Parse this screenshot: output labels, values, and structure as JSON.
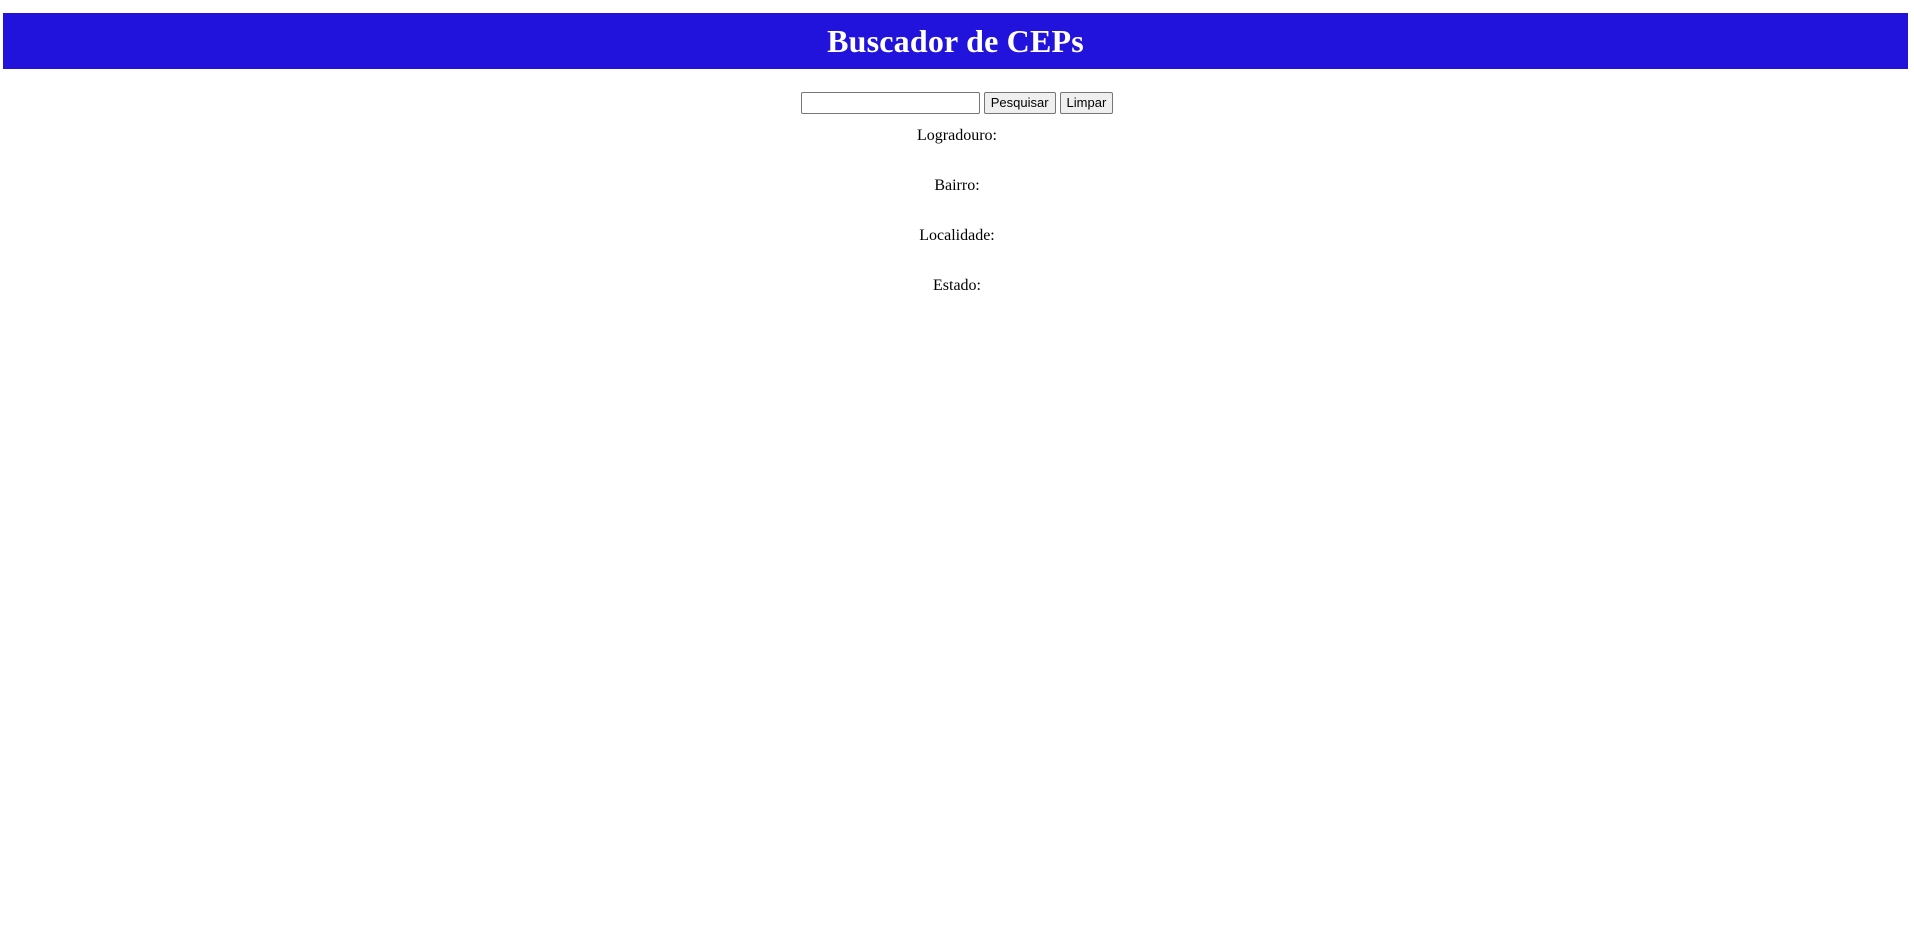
{
  "header": {
    "title": "Buscador de CEPs",
    "background_color": "#2112dc",
    "text_color": "#ffffff"
  },
  "search": {
    "input_value": "",
    "input_placeholder": "",
    "search_button_label": "Pesquisar",
    "clear_button_label": "Limpar"
  },
  "fields": {
    "logradouro_label": "Logradouro:",
    "bairro_label": "Bairro:",
    "localidade_label": "Localidade:",
    "estado_label": "Estado:"
  }
}
